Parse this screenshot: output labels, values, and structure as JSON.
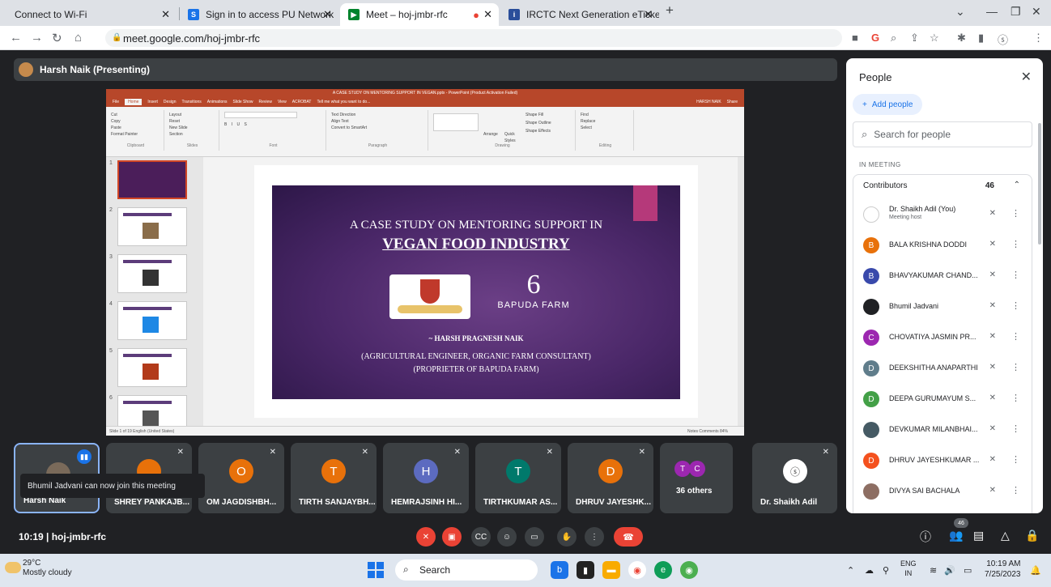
{
  "browser": {
    "tabs": [
      {
        "title": "Connect to Wi-Fi",
        "active": false
      },
      {
        "title": "Sign in to access PU Network",
        "active": false
      },
      {
        "title": "Meet – hoj-jmbr-rfc",
        "active": true
      },
      {
        "title": "IRCTC Next Generation eTicketing",
        "active": false
      }
    ],
    "new_tab": "+",
    "url": "meet.google.com/hoj-jmbr-rfc"
  },
  "presenting_label": "Harsh Naik (Presenting)",
  "ppt": {
    "window_title": "A CASE STUDY ON MENTORING SUPPORT IN VEGAN.pptx - PowerPoint (Product Activation Failed)",
    "tabs": [
      "File",
      "Home",
      "Insert",
      "Design",
      "Transitions",
      "Animations",
      "Slide Show",
      "Review",
      "View",
      "ACROBAT",
      "Tell me what you want to do..."
    ],
    "user": "HARSH NAIK",
    "share": "Share",
    "ribbon_groups": [
      "Clipboard",
      "Slides",
      "Font",
      "Paragraph",
      "Drawing",
      "Editing"
    ],
    "ribbon_items": {
      "cut": "Cut",
      "copy": "Copy",
      "format_painter": "Format Painter",
      "paste": "Paste",
      "layout": "Layout",
      "reset": "Reset",
      "new_slide": "New Slide",
      "section": "Section",
      "text_direction": "Text Direction",
      "align_text": "Align Text",
      "smartart": "Convert to SmartArt",
      "arrange": "Arrange",
      "quick_styles": "Quick Styles",
      "shape_fill": "Shape Fill",
      "shape_outline": "Shape Outline",
      "shape_effects": "Shape Effects",
      "find": "Find",
      "replace": "Replace",
      "select": "Select"
    },
    "status_left": "Slide 1 of 19    English (United States)",
    "status_right": "Notes   Comments      84%",
    "slide": {
      "title_line1": "A CASE STUDY ON MENTORING SUPPORT IN",
      "title_line2": "VEGAN FOOD INDUSTRY",
      "logo2_mark": "6",
      "logo2_text": "BAPUDA FARM",
      "author": "~ HARSH PRAGNESH NAIK",
      "role1": "(AGRICULTURAL ENGINEER, ORGANIC FARM CONSULTANT)",
      "role2": "(PROPRIETER OF BAPUDA FARM)"
    },
    "thumb_numbers": [
      "1",
      "2",
      "3",
      "4",
      "5",
      "6"
    ]
  },
  "tiles": [
    {
      "name": "Harsh Naik",
      "initial": "",
      "color": "#7a6a5a",
      "speaking": true
    },
    {
      "name": "SHREY PANKAJB...",
      "initial": "",
      "color": "#e8710a",
      "speaking": false
    },
    {
      "name": "OM JAGDISHBH...",
      "initial": "O",
      "color": "#e8710a",
      "speaking": false
    },
    {
      "name": "TIRTH SANJAYBH...",
      "initial": "T",
      "color": "#e8710a",
      "speaking": false
    },
    {
      "name": "HEMRAJSINH HI...",
      "initial": "H",
      "color": "#5c6bc0",
      "speaking": false
    },
    {
      "name": "TIRTHKUMAR AS...",
      "initial": "T",
      "color": "#00796b",
      "speaking": false
    },
    {
      "name": "DHRUV JAYESHK...",
      "initial": "D",
      "color": "#e8710a",
      "speaking": false
    },
    {
      "name": "36 others",
      "initial": "",
      "color": "#3c4043",
      "speaking": false
    },
    {
      "name": "Dr. Shaikh Adil",
      "initial": "",
      "color": "#ffffff",
      "speaking": false
    }
  ],
  "others_avatars": [
    "T",
    "C"
  ],
  "toast": "Bhumil Jadvani can now join this meeting",
  "people_panel": {
    "title": "People",
    "add_people": "Add people",
    "search_placeholder": "Search for people",
    "in_meeting": "IN MEETING",
    "contributors_label": "Contributors",
    "contributors_count": "46",
    "participants": [
      {
        "name": "Dr. Shaikh Adil (You)",
        "sub": "Meeting host",
        "initial": "",
        "color": "#ffffff"
      },
      {
        "name": "BALA KRISHNA DODDI",
        "sub": "",
        "initial": "B",
        "color": "#e8710a"
      },
      {
        "name": "BHAVYAKUMAR CHAND...",
        "sub": "",
        "initial": "B",
        "color": "#3949ab"
      },
      {
        "name": "Bhumil Jadvani",
        "sub": "",
        "initial": "",
        "color": "#202124"
      },
      {
        "name": "CHOVATIYA JASMIN PR...",
        "sub": "",
        "initial": "C",
        "color": "#9c27b0"
      },
      {
        "name": "DEEKSHITHA ANAPARTHI",
        "sub": "",
        "initial": "D",
        "color": "#607d8b"
      },
      {
        "name": "DEEPA GURUMAYUM S...",
        "sub": "",
        "initial": "D",
        "color": "#43a047"
      },
      {
        "name": "DEVKUMAR MILANBHAI...",
        "sub": "",
        "initial": "",
        "color": "#455a64"
      },
      {
        "name": "DHRUV JAYESHKUMAR ...",
        "sub": "",
        "initial": "D",
        "color": "#f4511e"
      },
      {
        "name": "DIVYA SAI BACHALA",
        "sub": "",
        "initial": "",
        "color": "#8d6e63"
      }
    ]
  },
  "controls": {
    "time_code": "10:19  |  hoj-jmbr-rfc",
    "people_count": "46"
  },
  "taskbar": {
    "temp": "29°C",
    "weather": "Mostly cloudy",
    "search": "Search",
    "lang1": "ENG",
    "lang2": "IN",
    "time": "10:19 AM",
    "date": "7/25/2023"
  }
}
